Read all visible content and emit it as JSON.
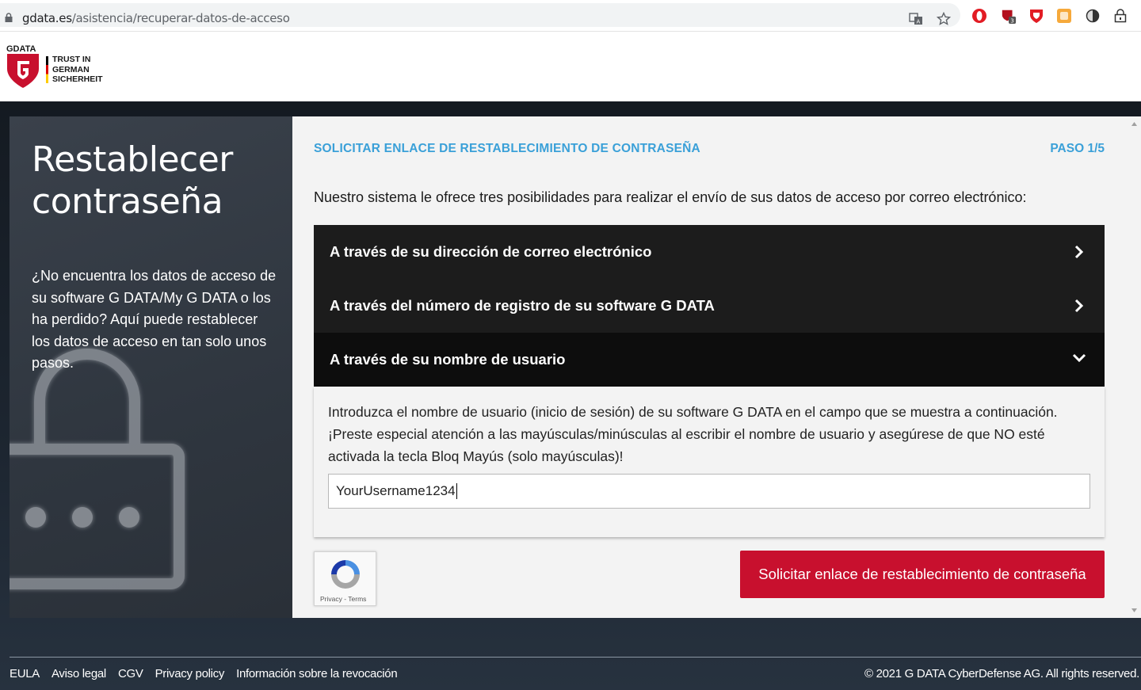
{
  "browser": {
    "url_domain": "gdata.es",
    "url_path": "/asistencia/recuperar-datos-de-acceso",
    "extension_badge": "3"
  },
  "logo": {
    "brand": "GDATA",
    "tagline_line1": "TRUST IN",
    "tagline_line2": "GERMAN",
    "tagline_line3": "SICHERHEIT"
  },
  "left_panel": {
    "title": "Restablecer contraseña",
    "text": "¿No encuentra los datos de acceso de su software G DATA/My G DATA o los ha perdido? Aquí puede restablecer los datos de acceso en tan solo unos pasos."
  },
  "form": {
    "step_title": "SOLICITAR ENLACE DE RESTABLECIMIENTO DE CONTRASEÑA",
    "step_num": "PASO 1/5",
    "intro": "Nuestro sistema le ofrece tres posibilidades para realizar el envío de sus datos de acceso por correo electrónico:",
    "options": [
      {
        "label": "A través de su dirección de correo electrónico",
        "state": "collapsed"
      },
      {
        "label": "A través del número de registro de su software G DATA",
        "state": "collapsed"
      },
      {
        "label": "A través de su nombre de usuario",
        "state": "expanded"
      }
    ],
    "username_instructions": "Introduzca el nombre de usuario (inicio de sesión) de su software G DATA en el campo que se muestra a continuación. ¡Preste especial atención a las mayúsculas/minúsculas al escribir el nombre de usuario y asegúrese de que NO esté activada la tecla Bloq Mayús (solo mayúsculas)!",
    "username_value": "YourUsername1234",
    "recaptcha_text": "Privacy - Terms",
    "submit_label": "Solicitar enlace de restablecimiento de contraseña"
  },
  "footer": {
    "links": [
      "EULA",
      "Aviso legal",
      "CGV",
      "Privacy policy",
      "Información sobre la revocación"
    ],
    "copyright": "© 2021 G DATA CyberDefense AG. All rights reserved."
  },
  "colors": {
    "accent_blue": "#3aa0d8",
    "brand_red": "#c8102e",
    "accordion_dark": "#1c1c1c"
  }
}
